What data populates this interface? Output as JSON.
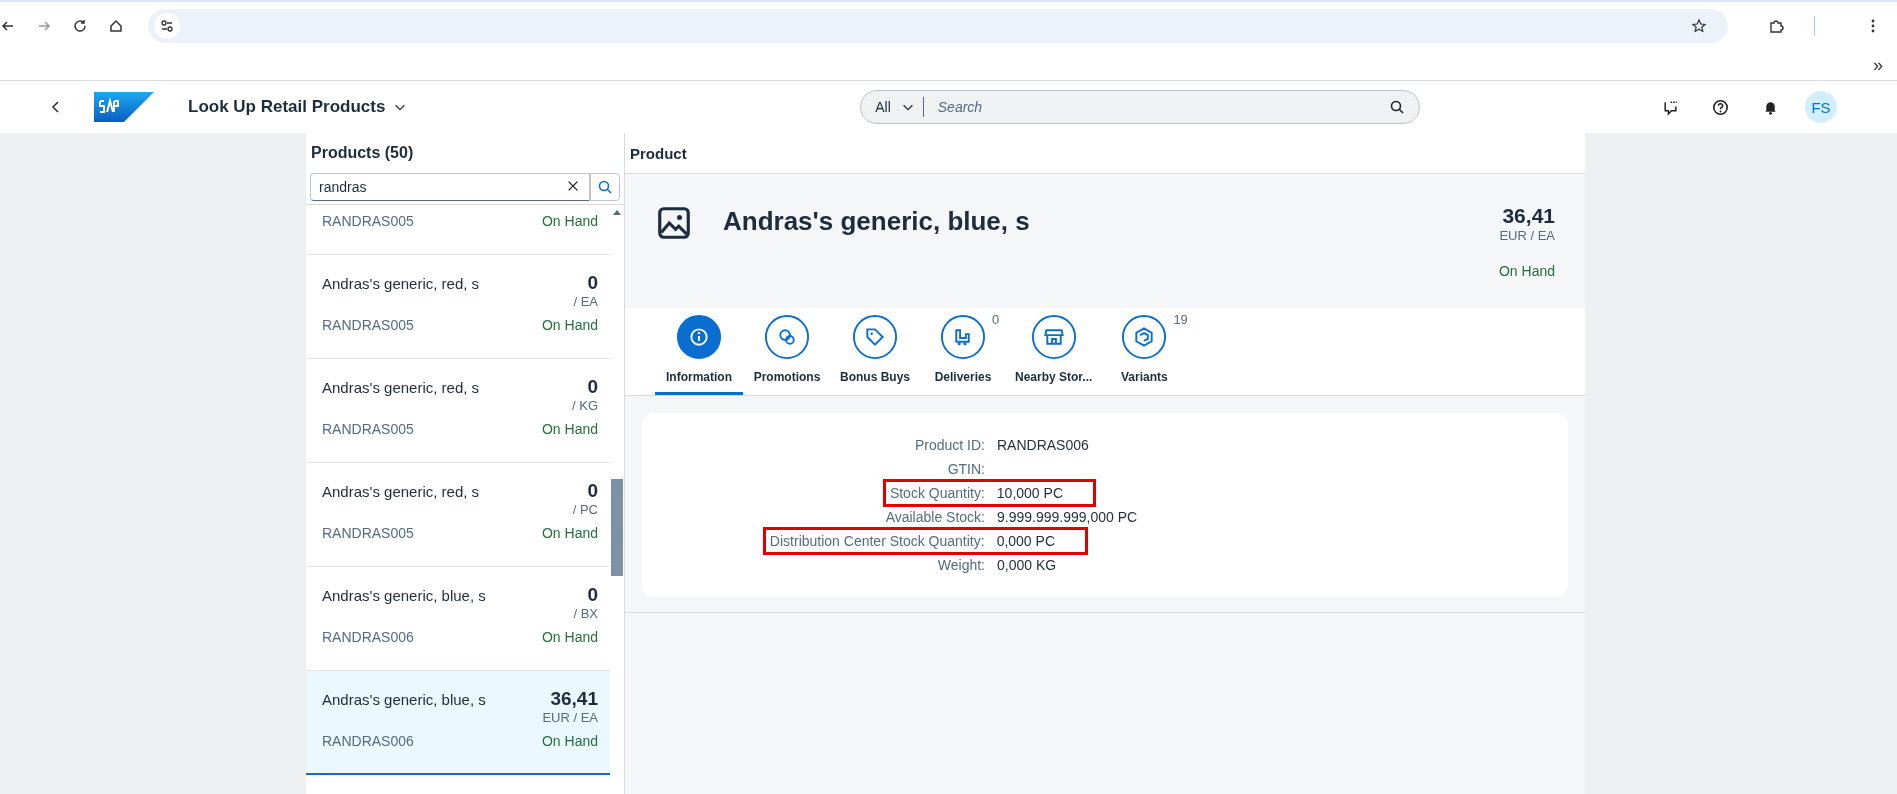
{
  "browser": {
    "bookmarks_overflow": "»"
  },
  "shell": {
    "app_title": "Look Up Retail Products",
    "search_scope": "All",
    "search_placeholder": "Search",
    "avatar": "FS"
  },
  "list": {
    "title": "Products (50)",
    "search_value": "randras",
    "items": [
      {
        "id": "RANDRAS005",
        "status": "On Hand",
        "selected": false
      },
      {
        "name": "Andras's generic, red, s",
        "price": "0",
        "unit": "/ EA",
        "id": "RANDRAS005",
        "status": "On Hand",
        "selected": false
      },
      {
        "name": "Andras's generic, red, s",
        "price": "0",
        "unit": "/ KG",
        "id": "RANDRAS005",
        "status": "On Hand",
        "selected": false
      },
      {
        "name": "Andras's generic, red, s",
        "price": "0",
        "unit": "/ PC",
        "id": "RANDRAS005",
        "status": "On Hand",
        "selected": false
      },
      {
        "name": "Andras's generic, blue, s",
        "price": "0",
        "unit": "/ BX",
        "id": "RANDRAS006",
        "status": "On Hand",
        "selected": false
      },
      {
        "name": "Andras's generic, blue, s",
        "price": "36,41",
        "unit": "EUR / EA",
        "id": "RANDRAS006",
        "status": "On Hand",
        "selected": true
      }
    ]
  },
  "detail": {
    "title": "Product",
    "name": "Andras's generic, blue, s",
    "price": "36,41",
    "unit": "EUR / EA",
    "status": "On Hand",
    "tabs": [
      {
        "kind": "info",
        "label": "Information",
        "selected": true
      },
      {
        "kind": "promo",
        "label": "Promotions",
        "selected": false
      },
      {
        "kind": "tag",
        "label": "Bonus Buys",
        "selected": false
      },
      {
        "kind": "truck",
        "label": "Deliveries",
        "count": "0",
        "selected": false
      },
      {
        "kind": "store",
        "label": "Nearby Stor...",
        "selected": false
      },
      {
        "kind": "cube",
        "label": "Variants",
        "count": "19",
        "selected": false
      }
    ],
    "fields": [
      {
        "label": "Product ID:",
        "value": "RANDRAS006",
        "highlighted": false
      },
      {
        "label": "GTIN:",
        "highlighted": false
      },
      {
        "label": "Stock Quantity:",
        "value": "10,000 PC",
        "highlighted": true
      },
      {
        "label": "Available Stock:",
        "value": "9.999.999.999,000 PC",
        "highlighted": false
      },
      {
        "label": "Distribution Center Stock Quantity:",
        "value": "0,000 PC",
        "highlighted": true
      },
      {
        "label": "Weight:",
        "value": "0,000 KG",
        "highlighted": false
      }
    ]
  }
}
